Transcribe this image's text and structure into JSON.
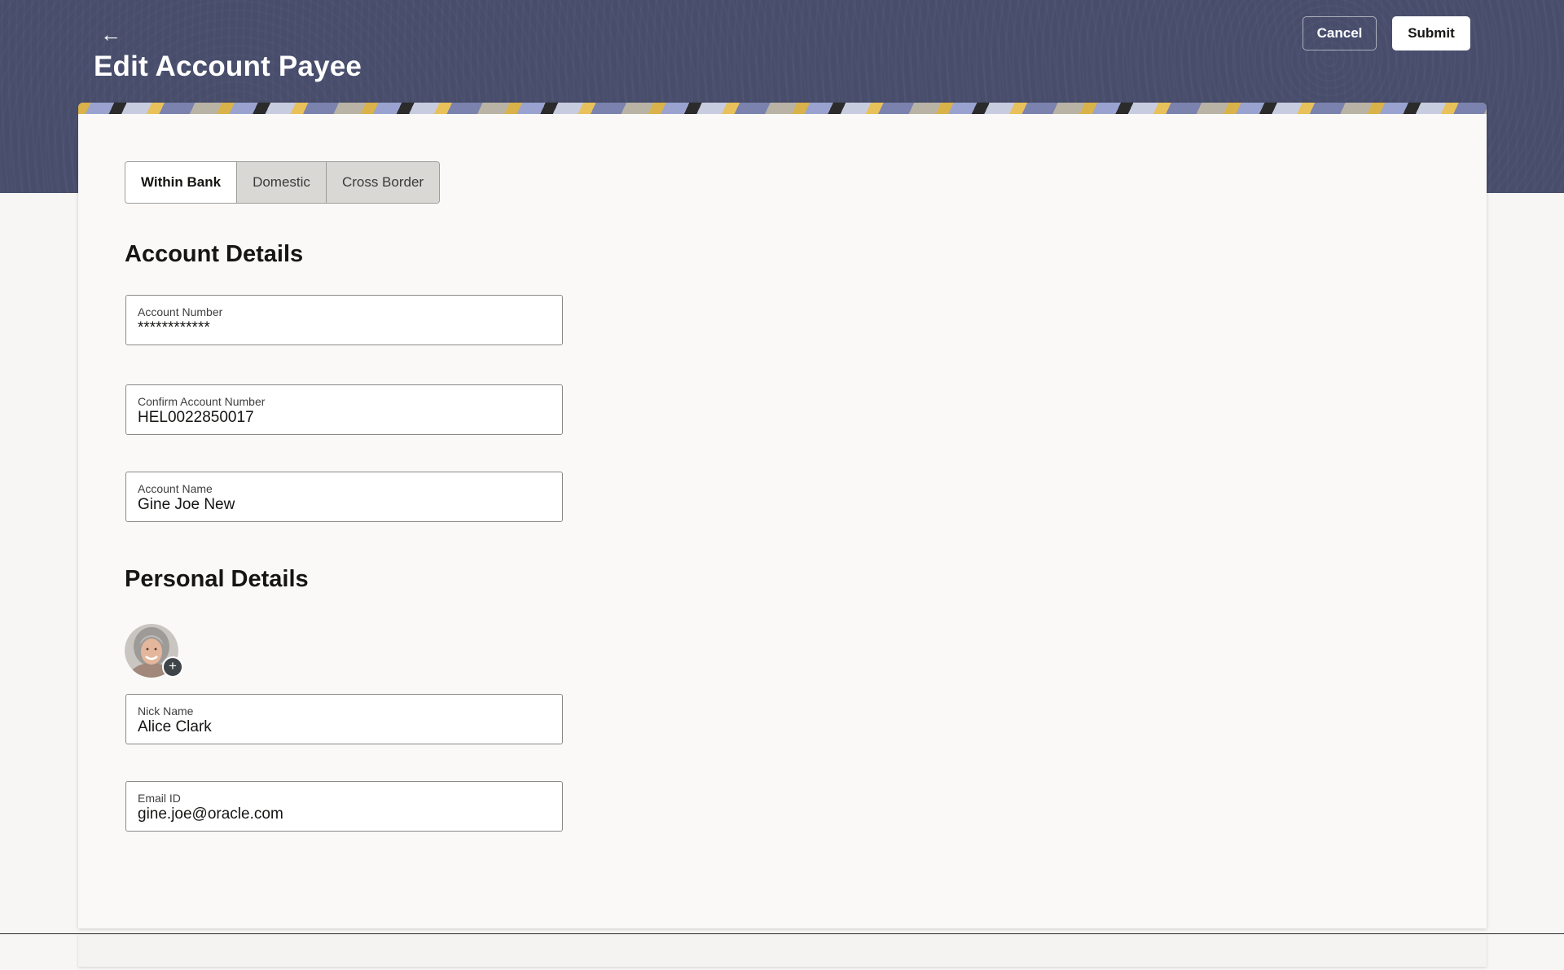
{
  "header": {
    "back_icon": "arrow-left-icon",
    "back_glyph": "←",
    "title": "Edit Account Payee",
    "cancel_label": "Cancel",
    "submit_label": "Submit",
    "background_color": "#474d6b"
  },
  "tabs": [
    {
      "label": "Within Bank",
      "active": true
    },
    {
      "label": "Domestic",
      "active": false
    },
    {
      "label": "Cross Border",
      "active": false
    }
  ],
  "account_details": {
    "heading": "Account Details",
    "fields": [
      {
        "label": "Account Number",
        "value": "************"
      },
      {
        "label": "Confirm Account Number",
        "value": "HEL0022850017"
      },
      {
        "label": "Account Name",
        "value": "Gine Joe New"
      }
    ]
  },
  "personal_details": {
    "heading": "Personal Details",
    "avatar_add_glyph": "+",
    "fields": [
      {
        "label": "Nick Name",
        "value": "Alice Clark"
      },
      {
        "label": "Email ID",
        "value": "gine.joe@oracle.com"
      }
    ]
  }
}
